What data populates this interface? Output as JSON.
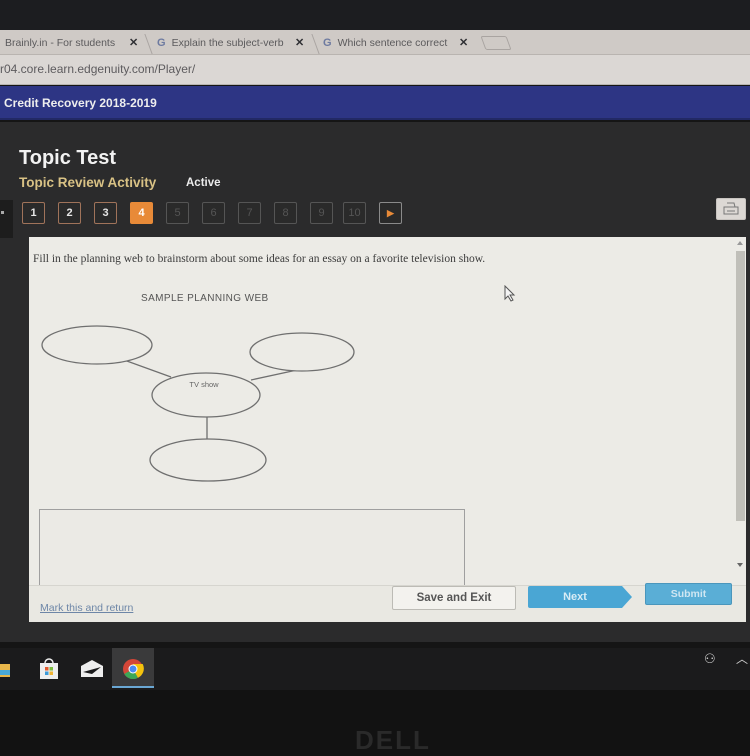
{
  "browser": {
    "tabs": [
      {
        "label": "Brainly.in - For students",
        "has_google_icon": false
      },
      {
        "label": "Explain the subject-verb",
        "has_google_icon": true
      },
      {
        "label": "Which sentence correct",
        "has_google_icon": true
      }
    ],
    "close_glyph": "✕",
    "google_glyph": "G",
    "url": "r04.core.learn.edgenuity.com/Player/"
  },
  "app": {
    "course_title": "Credit Recovery 2018-2019"
  },
  "activity": {
    "title": "Topic Test",
    "subtitle": "Topic Review Activity",
    "status": "Active",
    "questions": [
      {
        "label": "1",
        "state": "visited"
      },
      {
        "label": "2",
        "state": "visited"
      },
      {
        "label": "3",
        "state": "visited"
      },
      {
        "label": "4",
        "state": "active"
      },
      {
        "label": "5",
        "state": "disabled"
      },
      {
        "label": "6",
        "state": "disabled"
      },
      {
        "label": "7",
        "state": "disabled"
      },
      {
        "label": "8",
        "state": "disabled"
      },
      {
        "label": "9",
        "state": "disabled"
      },
      {
        "label": "10",
        "state": "disabled"
      }
    ],
    "next_arrow_glyph": "▶",
    "print_icon": "printer-icon"
  },
  "content": {
    "prompt": "Fill in the planning web to brainstorm about some ideas for an essay on a favorite television show.",
    "web_title": "SAMPLE PLANNING WEB",
    "center_node": "TV show",
    "answer_value": ""
  },
  "footer": {
    "mark_link": "Mark this and return",
    "save_exit": "Save and Exit",
    "next": "Next",
    "submit": "Submit"
  },
  "taskbar": {
    "icons": [
      "file-explorer-icon",
      "store-icon",
      "mail-icon",
      "chrome-icon"
    ],
    "tray_people_glyph": "⚇",
    "tray_caret_glyph": "︿"
  },
  "bezel": {
    "brand": "DELL"
  }
}
